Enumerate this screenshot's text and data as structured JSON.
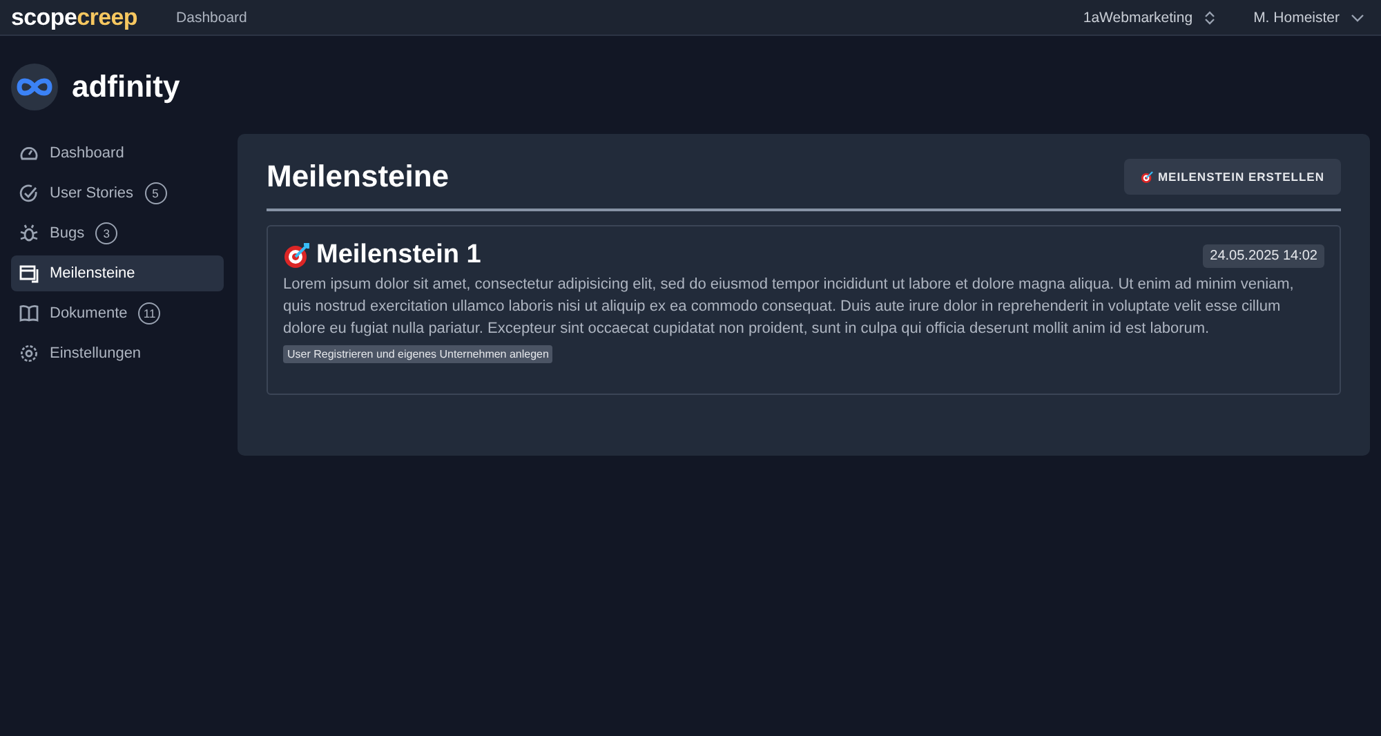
{
  "topbar": {
    "brand_primary": "scope",
    "brand_accent": "creep",
    "nav": [
      "Dashboard"
    ],
    "workspace": "1aWebmarketing",
    "user": "M. Homeister"
  },
  "sidebar": {
    "app_name": "adfinity",
    "items": [
      {
        "label": "Dashboard",
        "selected": false
      },
      {
        "label": "User Stories",
        "count": "5",
        "selected": false
      },
      {
        "label": "Bugs",
        "count": "3",
        "selected": false
      },
      {
        "label": "Meilensteine",
        "selected": true
      },
      {
        "label": "Dokumente",
        "count": "11",
        "selected": false
      },
      {
        "label": "Einstellungen",
        "selected": false
      }
    ]
  },
  "main": {
    "title": "Meilensteine",
    "create_button": "MEILENSTEIN ERSTELLEN",
    "milestones": [
      {
        "title": "Meilenstein 1",
        "date": "24.05.2025 14:02",
        "description": "Lorem ipsum dolor sit amet, consectetur adipisicing elit, sed do eiusmod tempor incididunt ut labore et dolore magna aliqua. Ut enim ad minim veniam, quis nostrud exercitation ullamco laboris nisi ut aliquip ex ea commodo consequat. Duis aute irure dolor in reprehenderit in voluptate velit esse cillum dolore eu fugiat nulla pariatur. Excepteur sint occaecat cupidatat non proident, sunt in culpa qui officia deserunt mollit anim id est laborum.",
        "tags": [
          "User Registrieren und eigenes Unternehmen anlegen"
        ]
      }
    ]
  }
}
